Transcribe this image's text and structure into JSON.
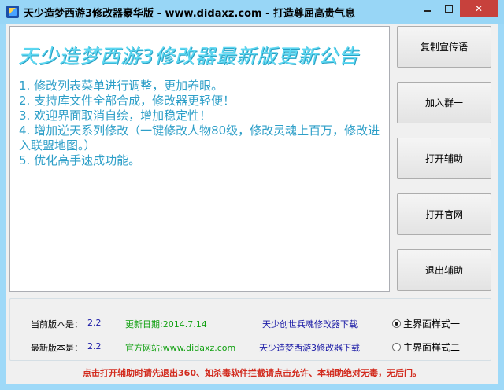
{
  "window": {
    "title": "天少造梦西游3修改器豪华版 - www.didaxz.com - 打造尊屈高贵气息",
    "close_glyph": "✕"
  },
  "announcement": {
    "headline": "天少造梦西游3修改器最新版更新公告",
    "items": [
      "1. 修改列表菜单进行调整，更加养眼。",
      "2. 支持库文件全部合成，修改器更轻便！",
      "3. 欢迎界面取消自绘，增加稳定性！",
      "4. 增加逆天系列修改（一键修改人物80级，修改灵魂上百万，修改进入联盟地图。）",
      "5. 优化高手速成功能。"
    ]
  },
  "buttons": {
    "copy_slogan": "复制宣传语",
    "join_group": "加入群一",
    "open_helper": "打开辅助",
    "open_site": "打开官网",
    "exit_helper": "退出辅助"
  },
  "info": {
    "current_version_label": "当前版本是：",
    "current_version_value": "2.2",
    "latest_version_label": "最新版本是：",
    "latest_version_value": "2.2",
    "update_date": "更新日期:2014.7.14",
    "official_site": "官方网站:www.didaxz.com",
    "download_link_1": "天少创世兵魂修改器下载",
    "download_link_2": "天少造梦西游3修改器下载",
    "style_option_1": "主界面样式一",
    "style_option_2": "主界面样式二",
    "selected_style": 1
  },
  "footer_notice": "点击打开辅助时请先退出360、如杀毒软件拦截请点击允许、本辅助绝对无毒，无后门。",
  "colors": {
    "title_bar": "#98d6f6",
    "close_button": "#c7413c",
    "headline": "#5dd8f2",
    "notice_text": "#2e9fc8",
    "link_blue": "#1a1aa6",
    "green_text": "#11a011",
    "footer_red": "#d22b1e"
  }
}
